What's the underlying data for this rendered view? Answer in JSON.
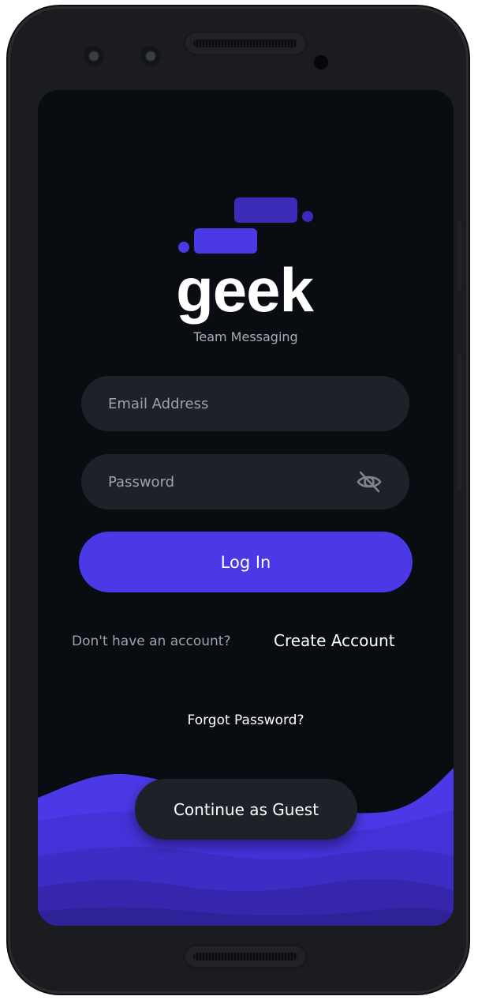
{
  "app": {
    "logo_word": "geek",
    "tagline": "Team Messaging"
  },
  "login_form": {
    "email_placeholder": "Email Address",
    "password_placeholder": "Password",
    "password_visibility_icon": "eye-off-icon",
    "login_label": "Log In"
  },
  "signup": {
    "question": "Don't have an account?",
    "create_account_label": "Create Account"
  },
  "forgot_password_label": "Forgot Password?",
  "guest_label": "Continue as Guest",
  "colors": {
    "accent": "#4b39e8",
    "logo_accent_dark": "#3a2bb8",
    "background": "#090d12",
    "field_background": "#1e2228",
    "text_primary": "#ffffff",
    "text_secondary": "#9ea3ab"
  }
}
